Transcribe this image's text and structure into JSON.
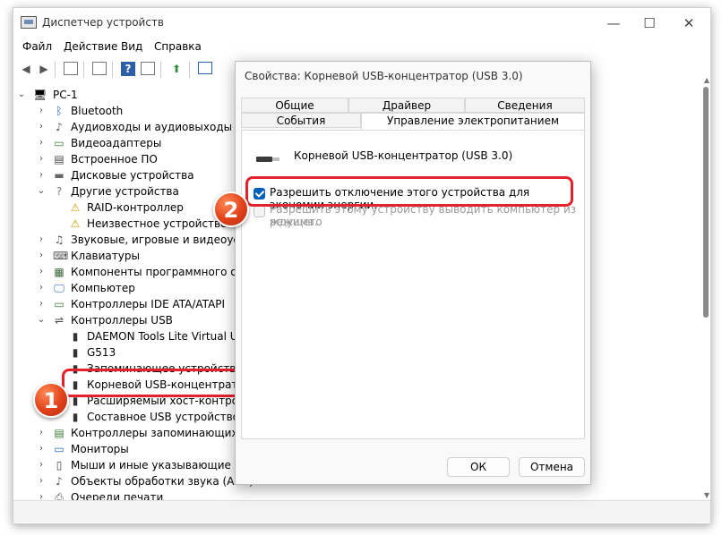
{
  "window": {
    "title": "Диспетчер устройств",
    "controls": {
      "minimize": "—",
      "maximize": "☐",
      "close": "✕"
    }
  },
  "menu": [
    "Файл",
    "Действие",
    "Вид",
    "Справка"
  ],
  "tree": {
    "root": "PC-1",
    "items": [
      {
        "label": "Bluetooth",
        "icon": "bluetooth-icon",
        "expanded": false
      },
      {
        "label": "Аудиовходы и аудиовыходы",
        "icon": "audio-icon",
        "expanded": false
      },
      {
        "label": "Видеоадаптеры",
        "icon": "display-adapter-icon",
        "expanded": false
      },
      {
        "label": "Встроенное ПО",
        "icon": "firmware-icon",
        "expanded": false
      },
      {
        "label": "Дисковые устройства",
        "icon": "disk-icon",
        "expanded": false
      },
      {
        "label": "Другие устройства",
        "icon": "unknown-device-icon",
        "expanded": true
      },
      {
        "label": "RAID-контроллер",
        "icon": "warning-device-icon",
        "child": true
      },
      {
        "label": "Неизвестное устройство",
        "icon": "warning-device-icon",
        "child": true
      },
      {
        "label": "Звуковые, игровые и видеоустро",
        "icon": "sound-icon",
        "expanded": false
      },
      {
        "label": "Клавиатуры",
        "icon": "keyboard-icon",
        "expanded": false
      },
      {
        "label": "Компоненты программного обес",
        "icon": "software-component-icon",
        "expanded": false
      },
      {
        "label": "Компьютер",
        "icon": "computer-icon",
        "expanded": false
      },
      {
        "label": "Контроллеры IDE ATA/ATAPI",
        "icon": "ide-icon",
        "expanded": false
      },
      {
        "label": "Контроллеры USB",
        "icon": "usb-icon",
        "expanded": true
      },
      {
        "label": "DAEMON Tools Lite Virtual USB",
        "icon": "usb-plug-icon",
        "child": true
      },
      {
        "label": "G513",
        "icon": "usb-plug-icon",
        "child": true
      },
      {
        "label": "Запоминающее устройство д",
        "icon": "usb-plug-icon",
        "child": true
      },
      {
        "label": "Корневой USB-концентратор",
        "icon": "usb-plug-icon",
        "child": true
      },
      {
        "label": "Расширяемый хост-контролл",
        "icon": "usb-plug-icon",
        "child": true
      },
      {
        "label": "Составное USB устройство",
        "icon": "usb-plug-icon",
        "child": true
      },
      {
        "label": "Контроллеры запоминающих устр",
        "icon": "storage-controller-icon",
        "expanded": false
      },
      {
        "label": "Мониторы",
        "icon": "monitor-icon",
        "expanded": false
      },
      {
        "label": "Мыши и иные указывающие устро",
        "icon": "mouse-icon",
        "expanded": false
      },
      {
        "label": "Объекты обработки звука (APO)",
        "icon": "apo-icon",
        "expanded": false
      },
      {
        "label": "Очереди печати",
        "icon": "printer-icon",
        "expanded": false
      }
    ]
  },
  "dialog": {
    "title": "Свойства: Корневой USB-концентратор (USB 3.0)",
    "tabs_row1": [
      "Общие",
      "Драйвер",
      "Сведения"
    ],
    "tabs_row2": [
      "События",
      "Управление электропитанием"
    ],
    "device_name": "Корневой USB-концентратор (USB 3.0)",
    "option1": "Разрешить отключение этого устройства для экономии энергии.",
    "option2_line1": "Разрешить этому устройству выводить компьютер из ждущего",
    "option2_line2": "режима.",
    "ok": "ОК",
    "cancel": "Отмена"
  },
  "annotations": {
    "badge1": "1",
    "badge2": "2",
    "accent": "#e5222a"
  }
}
